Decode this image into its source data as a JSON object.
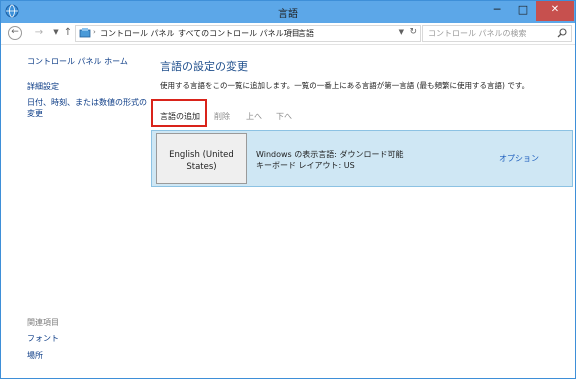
{
  "window": {
    "title": "言語",
    "buttons": {
      "minimize": "─",
      "maximize": "□",
      "close": "✕"
    }
  },
  "navbar": {
    "back": "←",
    "forward": "→",
    "history": "▼",
    "up": "↑",
    "breadcrumbs": [
      "コントロール パネル",
      "すべてのコントロール パネル項目",
      "言語"
    ],
    "crumb_sep": "›",
    "refresh": "↻",
    "search_placeholder": "コントロール パネルの検索"
  },
  "sidebar": {
    "home": "コントロール パネル ホーム",
    "advanced": "詳細設定",
    "datetime_line1": "日付、時刻、または数値の形式の",
    "datetime_line2": "変更",
    "related_heading": "関連項目",
    "fonts": "フォント",
    "location": "場所"
  },
  "main": {
    "title": "言語の設定の変更",
    "description": "使用する言語をこの一覧に追加します。一覧の一番上にある言語が第一言語 (最も頻繁に使用する言語) です。",
    "toolbar": {
      "add": "言語の追加",
      "remove": "削除",
      "up": "上へ",
      "down": "下へ"
    },
    "language": {
      "name_line1": "English (United",
      "name_line2": "States)",
      "display_lang": "Windows の表示言語: ダウンロード可能",
      "keyboard": "キーボード レイアウト: US",
      "options": "オプション"
    }
  },
  "colors": {
    "titlebar": "#5ca7e8",
    "close": "#c7504e",
    "link": "#0b3b86",
    "highlight_row": "#cfe7f4",
    "annotation": "#d9231a"
  }
}
